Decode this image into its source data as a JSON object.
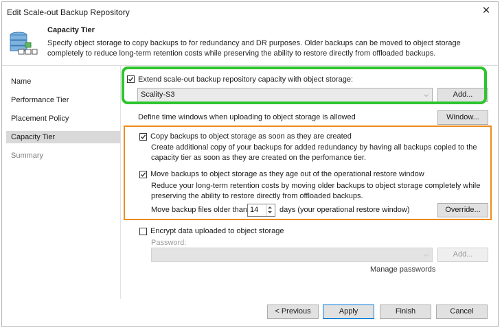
{
  "window": {
    "title": "Edit Scale-out Backup Repository"
  },
  "header": {
    "title": "Capacity Tier",
    "description": "Specify object storage to copy backups to for redundancy and DR purposes. Older backups can be moved to object storage completely to reduce long-term retention costs while preserving the ability to restore directly from offloaded backups."
  },
  "nav": {
    "items": [
      {
        "label": "Name"
      },
      {
        "label": "Performance Tier"
      },
      {
        "label": "Placement Policy"
      },
      {
        "label": "Capacity Tier"
      },
      {
        "label": "Summary"
      }
    ]
  },
  "extend": {
    "label": "Extend scale-out backup repository capacity with object storage:",
    "checked": true,
    "storage_value": "Scality-S3",
    "add_label": "Add..."
  },
  "windows": {
    "label": "Define time windows when uploading to object storage is allowed",
    "button_label": "Window..."
  },
  "copy": {
    "label": "Copy backups to object storage as soon as they are created",
    "checked": true,
    "description": "Create additional copy of your backups for added redundancy by having all backups copied to the capacity tier as soon as they are created on the perfomance tier."
  },
  "move": {
    "label": "Move backups to object storage as they age out of the operational restore window",
    "checked": true,
    "description": "Reduce your long-term retention costs by moving older backups to object storage completely while preserving the ability to restore directly from offloaded backups.",
    "older_than_label": "Move backup files older than",
    "days_value": "14",
    "days_suffix": "days (your operational restore window)",
    "override_label": "Override..."
  },
  "encrypt": {
    "label": "Encrypt data uploaded to object storage",
    "checked": false,
    "password_label": "Password:",
    "add_label": "Add...",
    "manage_label": "Manage passwords"
  },
  "footer": {
    "previous": "< Previous",
    "apply": "Apply",
    "finish": "Finish",
    "cancel": "Cancel"
  },
  "colors": {
    "highlight_green": "#2ec42e",
    "highlight_orange": "#ee8a1c",
    "nav_active": "#d9d9d9"
  }
}
